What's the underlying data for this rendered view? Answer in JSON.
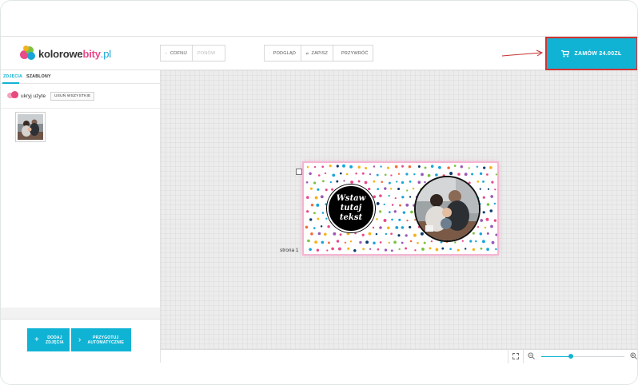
{
  "brand": {
    "logo_text_a": "kolorowe",
    "logo_text_b": "bity",
    "logo_text_c": ".pl"
  },
  "toolbar": {
    "undo_label": "COFNIJ",
    "redo_label": "PONÓW",
    "preview_label": "PODGLĄD",
    "save_label": "ZAPISZ",
    "restore_label": "PRZYWRÓĆ",
    "order_label": "ZAMÓW 24.00ZŁ"
  },
  "sidebar": {
    "tabs": [
      {
        "label": "ZDJĘCIA",
        "active": true
      },
      {
        "label": "SZABLONY",
        "active": false
      }
    ],
    "hide_used_label": "ukryj użyte",
    "hide_used_on": true,
    "remove_all_label": "USUŃ WSZYSTKIE",
    "add_photos_label": "DODAJ\nZDJĘCIA",
    "auto_fill_label": "PRZYGOTUJ\nAUTOMATYCZNIE"
  },
  "canvas": {
    "page_label": "strona 1",
    "placeholder_text": "Wstaw\ntutaj\ntekst"
  },
  "zoom": {
    "level": 0.36
  },
  "colors": {
    "accent": "#11b3d4",
    "brand_pink": "#e84a8a",
    "order_border": "#d23333"
  },
  "icons": [
    "undo-icon",
    "redo-icon",
    "eye-icon",
    "save-icon",
    "restore-icon",
    "cart-icon",
    "plus-icon",
    "chevron-right-icon",
    "fullscreen-icon",
    "zoom-out-icon",
    "zoom-in-icon"
  ]
}
